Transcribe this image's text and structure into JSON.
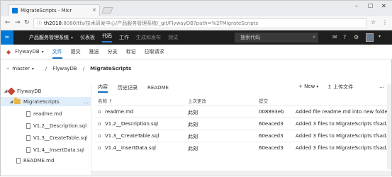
{
  "browser": {
    "tab_title": "MigrateScripts - Micr",
    "tab_close": "×",
    "url_host": "th2018",
    "url_rest": ":8080/tfs/技术研发中心/产品服务管理系统/_git/FlywayDB?path=%2FMigrateScripts",
    "window_controls": [
      "–",
      "☐",
      "✕"
    ]
  },
  "topnav": {
    "project": "产品服务管理系统",
    "items": [
      "仪表板",
      "代码",
      "工作",
      "生成和发布",
      "测试"
    ],
    "active": "代码",
    "search_placeholder": "搜索代码"
  },
  "subnav": {
    "repo": "FlywayDB",
    "items": [
      "文件",
      "提交",
      "推送",
      "分支",
      "标记",
      "拉取请求"
    ],
    "active": "文件"
  },
  "breadcrumb": {
    "branch": "master",
    "repo": "FlywayDB",
    "folder": "MigrateScripts"
  },
  "tree": {
    "root": "FlywayDB",
    "folder": "MigrateScripts",
    "files": [
      "readme.md",
      "V1.2__Description.sql",
      "V1.3__CreateTable.sql",
      "V1.4__InsertData.sql"
    ],
    "root_file": "README.md"
  },
  "content": {
    "tabs": [
      "内容",
      "历史记录",
      "README"
    ],
    "new_button": "New",
    "upload_button": "上传文件",
    "headers": {
      "name": "名称",
      "last_change": "上次更改",
      "commit": "提交"
    },
    "rows": [
      {
        "name": "readme.md",
        "last_change": "此刻",
        "commit": "008893eb",
        "message": "Added file readme.md into new folde..."
      },
      {
        "name": "V1.2__Description.sql",
        "last_change": "此刻",
        "commit": "60eaced3",
        "message": "Added 3 files to MigrateScripts  tfsad..."
      },
      {
        "name": "V1.3__CreateTable.sql",
        "last_change": "此刻",
        "commit": "60eaced3",
        "message": "Added 3 files to MigrateScripts  tfsad..."
      },
      {
        "name": "V1.4__InsertData.sql",
        "last_change": "此刻",
        "commit": "60eaced3",
        "message": "Added 3 files to MigrateScripts  tfsad..."
      }
    ]
  }
}
